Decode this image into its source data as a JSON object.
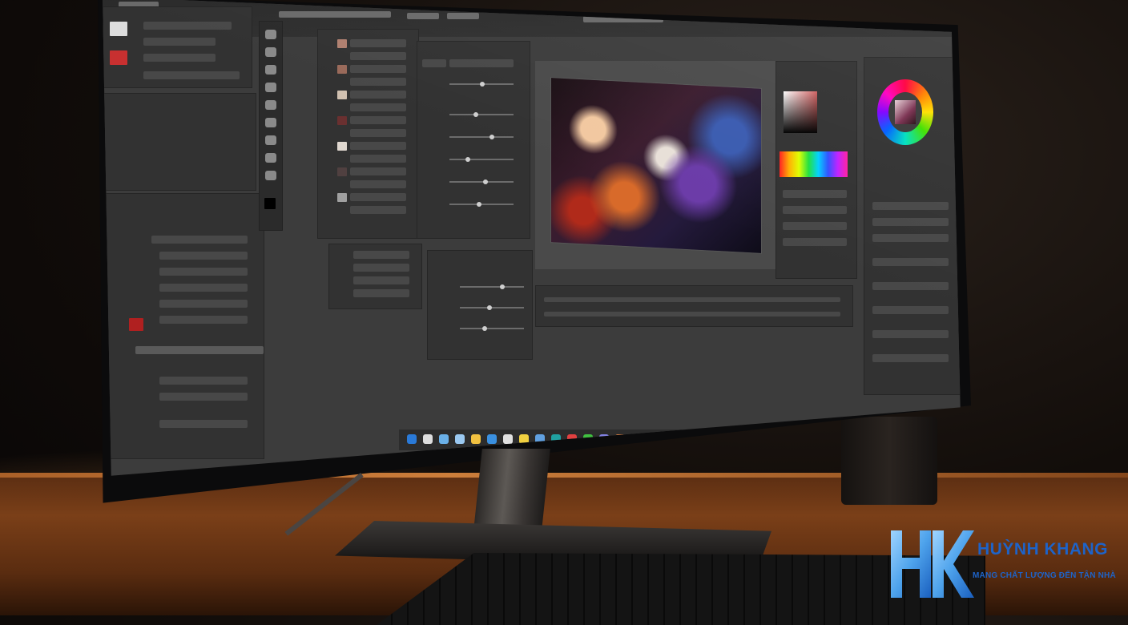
{
  "brand": {
    "name": "HUỲNH KHANG",
    "tagline": "MANG CHẤT LƯỢNG ĐẾN TẬN NHÀ",
    "colors": {
      "primary": "#1e63c8",
      "mark_light": "#6fb6f5",
      "mark_dark": "#1a5fbf"
    }
  },
  "scene": {
    "icons": {
      "logo": "hk-logo-icon",
      "color_wheel": "color-wheel-icon"
    }
  }
}
